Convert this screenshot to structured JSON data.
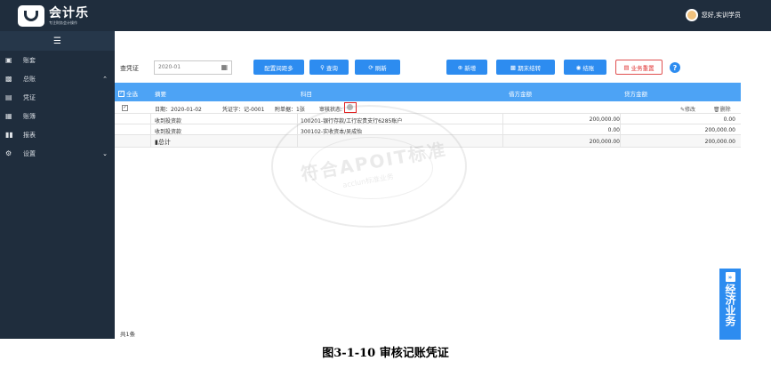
{
  "header": {
    "logo_name": "会计乐",
    "logo_sub": "专注财务会计操作",
    "greeting": "您好,实训学员"
  },
  "sidebar": {
    "menu_icon": "menu-icon",
    "items": [
      {
        "label": "账套",
        "icon": "book-icon",
        "chevron": ""
      },
      {
        "label": "总账",
        "icon": "ledger-icon",
        "chevron": "^"
      },
      {
        "label": "凭证",
        "icon": "voucher-icon",
        "chevron": ""
      },
      {
        "label": "账簿",
        "icon": "account-book-icon",
        "chevron": ""
      },
      {
        "label": "报表",
        "icon": "report-icon",
        "chevron": ""
      },
      {
        "label": "设置",
        "icon": "settings-icon",
        "chevron": "v"
      }
    ]
  },
  "toolbar": {
    "period_label": "查凭证",
    "period_value": "2020-01",
    "config_button": "配置间距多",
    "query_button": "查询",
    "refresh_button": "刷新",
    "add_button": "新增",
    "period_end_button": "期末结转",
    "settle_button": "结账",
    "reset_button": "业务重置",
    "help": "?"
  },
  "table": {
    "select_all": "全选",
    "headers": {
      "summary": "摘要",
      "subject": "科目",
      "debit": "借方金额",
      "credit": "贷方金额"
    },
    "voucher_info": {
      "date": "日期：2020-01-02",
      "voucher_no": "凭证字：记-0001",
      "attachments": "附单据：1张",
      "audit_status": "审核状态:",
      "edit": "修改",
      "delete": "删除"
    },
    "rows": [
      {
        "summary": "收到投资款",
        "subject": "100201-银行存款/工行宏贵支行6285账户",
        "debit": "200,000.00",
        "credit": "0.00"
      },
      {
        "summary": "收到投资款",
        "subject": "300102-实收资本/吴成怡",
        "debit": "0.00",
        "credit": "200,000.00"
      }
    ],
    "total": {
      "label": "总计",
      "debit": "200,000.00",
      "credit": "200,000.00"
    }
  },
  "watermark": {
    "text": "符合APOIT标准",
    "sub": "acclun标准业务"
  },
  "footer": {
    "count": "共1条"
  },
  "side_tab": {
    "arrow": "»",
    "text": "经济业务"
  },
  "caption": "图3-1-10 审核记账凭证",
  "colors": {
    "sidebar": "#1f2d3d",
    "accent": "#2d8cf0",
    "table_header": "#4da3f5",
    "danger": "#e03030"
  }
}
